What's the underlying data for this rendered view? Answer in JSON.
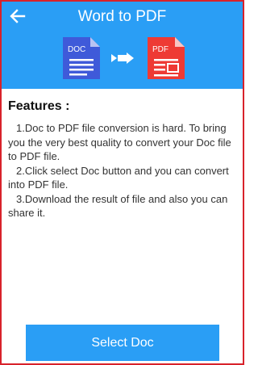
{
  "header": {
    "title": "Word to PDF",
    "back_icon": "arrow-left-icon",
    "source_icon": {
      "label": "DOC",
      "color": "#3f5ad9"
    },
    "arrow_icon": "double-chevron-right-icon",
    "target_icon": {
      "label": "PDF",
      "color": "#ee3a34"
    }
  },
  "features": {
    "heading": "Features :",
    "items": [
      "1.Doc to PDF file conversion is hard. To bring you the very best quality to convert your Doc file to PDF file.",
      "2.Click select Doc button and you can convert into PDF file.",
      "3.Download the result of file and also you can share it."
    ]
  },
  "action": {
    "select_label": "Select Doc"
  },
  "colors": {
    "accent": "#2a9ef5",
    "frame_border": "#d8222b"
  }
}
